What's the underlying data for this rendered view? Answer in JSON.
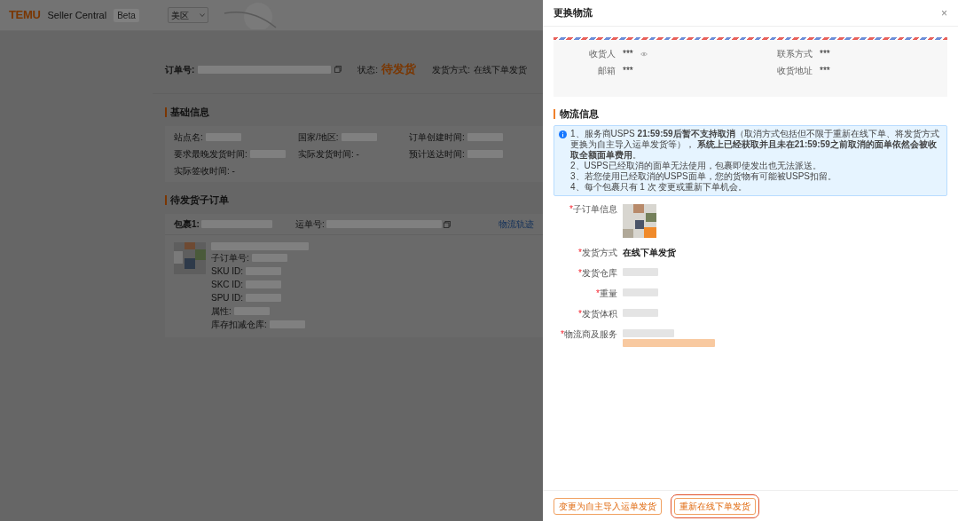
{
  "header": {
    "logo": "TEMU",
    "app_name": "Seller Central",
    "badge": "Beta",
    "region": "美区"
  },
  "order": {
    "number_label": "订单号:",
    "status_label": "状态:",
    "status": "待发货",
    "method_label": "发货方式:",
    "method": "在线下单发货"
  },
  "basic_info": {
    "title": "基础信息",
    "fields": [
      {
        "label": "站点名:"
      },
      {
        "label": "国家/地区:"
      },
      {
        "label": "订单创建时间:"
      },
      {
        "label": "要求最晚发货时间:"
      },
      {
        "text": "实际发货时间: -"
      },
      {
        "label": "预计送达时间:"
      },
      {
        "text": "实际签收时间: -"
      }
    ]
  },
  "sub_orders": {
    "title": "待发货子订单",
    "package_label": "包裹1:",
    "waybill_label": "运单号:",
    "track_link": "物流轨迹",
    "item_fields": [
      "子订单号:",
      "SKU ID:",
      "SKC ID:",
      "SPU ID:",
      "属性:",
      "库存扣减仓库:"
    ]
  },
  "drawer": {
    "title": "更换物流",
    "close": "×",
    "recipient": [
      {
        "label": "收货人",
        "value": "***"
      },
      {
        "label": "联系方式",
        "value": "***"
      },
      {
        "label": "邮箱",
        "value": "***"
      },
      {
        "label": "收货地址",
        "value": "***"
      }
    ],
    "section_title": "物流信息",
    "notice": [
      "1、服务商USPS **21:59:59后暂不支持取消**（取消方式包括但不限于重新在线下单、将发货方式更换为自主导入运单发货等）， **系统上已经获取并且未在21:59:59之前取消的面单依然会被收取全额面单费用**。",
      "2、USPS已经取消的面单无法使用，包裹即使发出也无法派送。",
      "3、若您使用已经取消的USPS面单，您的货物有可能被USPS扣留。",
      "4、每个包裹只有 1 次 变更或重新下单机会。"
    ],
    "form": [
      {
        "label": "*子订单信息"
      },
      {
        "label": "*发货方式",
        "kind": "text",
        "value": "在线下单发货"
      },
      {
        "label": "*发货仓库",
        "kind": "redacted"
      },
      {
        "label": "*重量",
        "kind": "redacted"
      },
      {
        "label": "*发货体积",
        "kind": "redacted"
      },
      {
        "label": "*物流商及服务",
        "kind": "service"
      }
    ],
    "buttons": [
      {
        "label": "变更为自主导入运单发货",
        "highlighted": false
      },
      {
        "label": "重新在线下单发货",
        "highlighted": true
      }
    ]
  }
}
